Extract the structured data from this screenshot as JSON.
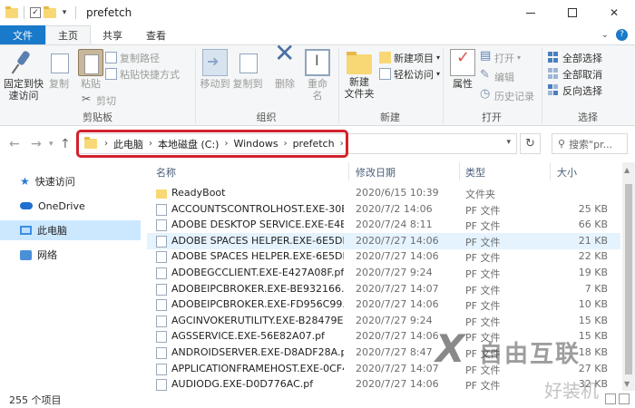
{
  "window": {
    "title": "prefetch"
  },
  "ribbon_tabs": {
    "file": "文件",
    "home": "主页",
    "share": "共享",
    "view": "查看"
  },
  "ribbon": {
    "clipboard": {
      "pin": "固定到快\n速访问",
      "copy": "复制",
      "paste": "粘贴",
      "copy_path": "复制路径",
      "paste_shortcut": "粘贴快捷方式",
      "cut": "剪切",
      "label": "剪贴板"
    },
    "organize": {
      "move_to": "移动到",
      "copy_to": "复制到",
      "delete": "删除",
      "rename": "重命名",
      "label": "组织"
    },
    "new": {
      "new_folder": "新建\n文件夹",
      "new_item": "新建项目",
      "easy_access": "轻松访问",
      "label": "新建"
    },
    "open": {
      "properties": "属性",
      "open": "打开",
      "edit": "编辑",
      "history": "历史记录",
      "label": "打开"
    },
    "select": {
      "select_all": "全部选择",
      "select_none": "全部取消",
      "invert": "反向选择",
      "label": "选择"
    }
  },
  "address": {
    "crumbs": [
      "此电脑",
      "本地磁盘 (C:)",
      "Windows",
      "prefetch"
    ],
    "search_placeholder": "搜索\"pr..."
  },
  "nav": {
    "items": [
      "快速访问",
      "OneDrive",
      "此电脑",
      "网络"
    ]
  },
  "columns": {
    "name": "名称",
    "date": "修改日期",
    "type": "类型",
    "size": "大小"
  },
  "files": [
    {
      "name": "ReadyBoot",
      "date": "2020/6/15 10:39",
      "type": "文件夹",
      "size": "",
      "folder": true
    },
    {
      "name": "ACCOUNTSCONTROLHOST.EXE-30B...",
      "date": "2020/7/2 14:06",
      "type": "PF 文件",
      "size": "25 KB"
    },
    {
      "name": "ADOBE DESKTOP SERVICE.EXE-E4EF...",
      "date": "2020/7/24 8:11",
      "type": "PF 文件",
      "size": "66 KB"
    },
    {
      "name": "ADOBE SPACES HELPER.EXE-6E5DB9...",
      "date": "2020/7/27 14:06",
      "type": "PF 文件",
      "size": "21 KB",
      "hover": true
    },
    {
      "name": "ADOBE SPACES HELPER.EXE-6E5DB9...",
      "date": "2020/7/27 14:06",
      "type": "PF 文件",
      "size": "22 KB"
    },
    {
      "name": "ADOBEGCCLIENT.EXE-E427A08F.pf",
      "date": "2020/7/27 9:24",
      "type": "PF 文件",
      "size": "19 KB"
    },
    {
      "name": "ADOBEIPCBROKER.EXE-BE932166.pf",
      "date": "2020/7/27 14:07",
      "type": "PF 文件",
      "size": "7 KB"
    },
    {
      "name": "ADOBEIPCBROKER.EXE-FD956C99.pf",
      "date": "2020/7/27 14:06",
      "type": "PF 文件",
      "size": "10 KB"
    },
    {
      "name": "AGCINVOKERUTILITY.EXE-B28479EC....",
      "date": "2020/7/27 9:24",
      "type": "PF 文件",
      "size": "15 KB"
    },
    {
      "name": "AGSSERVICE.EXE-56E82A07.pf",
      "date": "2020/7/27 14:06",
      "type": "PF 文件",
      "size": "15 KB"
    },
    {
      "name": "ANDROIDSERVER.EXE-D8ADF28A.pf",
      "date": "2020/7/27 8:47",
      "type": "PF 文件",
      "size": "18 KB"
    },
    {
      "name": "APPLICATIONFRAMEHOST.EXE-0CF4...",
      "date": "2020/7/27 14:07",
      "type": "PF 文件",
      "size": "27 KB"
    },
    {
      "name": "AUDIODG.EXE-D0D776AC.pf",
      "date": "2020/7/27 14:06",
      "type": "PF 文件",
      "size": "32 KB"
    }
  ],
  "status": {
    "count": "255 个项目"
  },
  "watermark": {
    "brand": "自由互联",
    "site": "好装机"
  }
}
